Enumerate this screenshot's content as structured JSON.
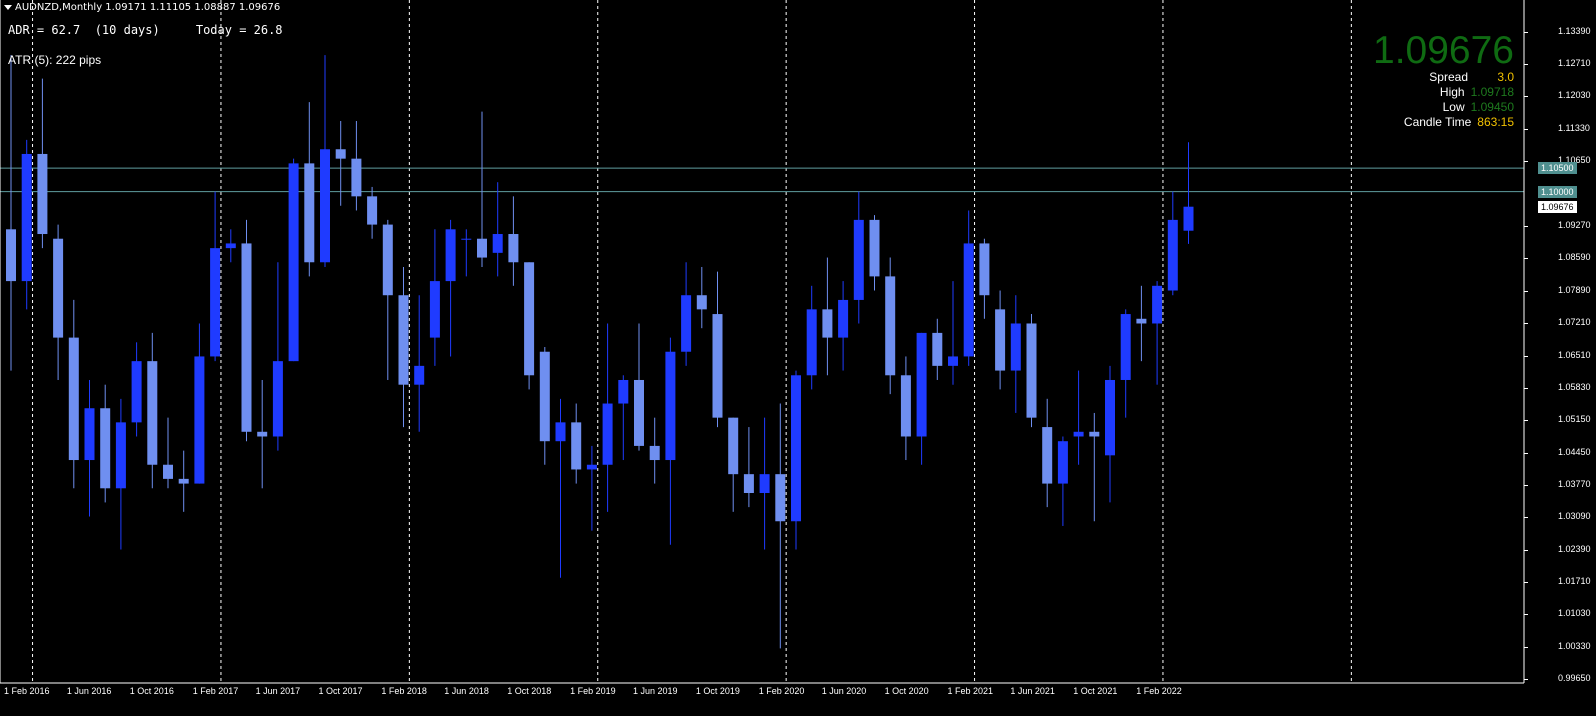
{
  "window": {
    "title": "AUDNZD,Monthly  1.09171 1.11105 1.08887 1.09676"
  },
  "indicators": {
    "adr": "ADR = 62.7  (10 days)     Today = 26.8",
    "atr": "ATR (5): 222 pips"
  },
  "info_panel": {
    "price": "1.09676",
    "spread_label": "Spread",
    "spread_value": "3.0",
    "high_label": "High",
    "high_value": "1.09718",
    "low_label": "Low",
    "low_value": "1.09450",
    "candle_time_label": "Candle Time",
    "candle_time_value": "863:15"
  },
  "price_axis": {
    "ticks": [
      "1.13390",
      "1.12710",
      "1.12030",
      "1.11330",
      "1.10650",
      "1.09270",
      "1.08590",
      "1.07890",
      "1.07210",
      "1.06510",
      "1.05830",
      "1.05150",
      "1.04450",
      "1.03770",
      "1.03090",
      "1.02390",
      "1.01710",
      "1.01030",
      "1.00330",
      "0.99650"
    ],
    "badges": [
      {
        "value": "1.10500",
        "bg": "#4f8f8f",
        "fg": "#ffffff",
        "price": 1.105
      },
      {
        "value": "1.10000",
        "bg": "#4f8f8f",
        "fg": "#ffffff",
        "price": 1.1
      },
      {
        "value": "1.09676",
        "bg": "#ffffff",
        "fg": "#000000",
        "price": 1.09676
      }
    ]
  },
  "time_axis": {
    "labels": [
      "1 Feb 2016",
      "1 Jun 2016",
      "1 Oct 2016",
      "1 Feb 2017",
      "1 Jun 2017",
      "1 Oct 2017",
      "1 Feb 2018",
      "1 Jun 2018",
      "1 Oct 2018",
      "1 Feb 2019",
      "1 Jun 2019",
      "1 Oct 2019",
      "1 Feb 2020",
      "1 Jun 2020",
      "1 Oct 2020",
      "1 Feb 2021",
      "1 Jun 2021",
      "1 Oct 2021",
      "1 Feb 2022"
    ]
  },
  "chart_data": {
    "type": "candlestick",
    "symbol": "AUDNZD",
    "timeframe": "Monthly",
    "y_range": [
      0.9965,
      1.1339
    ],
    "horizontal_levels": [
      1.105,
      1.1
    ],
    "colors": {
      "bull": "#1f3bff",
      "bear": "#6f8ff0",
      "grid": "#ffffff",
      "level": "#5f9ea0"
    },
    "candles": [
      {
        "t": "2015-12",
        "o": 1.092,
        "h": 1.129,
        "l": 1.062,
        "c": 1.081
      },
      {
        "t": "2016-01",
        "o": 1.081,
        "h": 1.111,
        "l": 1.075,
        "c": 1.108
      },
      {
        "t": "2016-02",
        "o": 1.108,
        "h": 1.124,
        "l": 1.088,
        "c": 1.091
      },
      {
        "t": "2016-03",
        "o": 1.09,
        "h": 1.093,
        "l": 1.06,
        "c": 1.069
      },
      {
        "t": "2016-04",
        "o": 1.069,
        "h": 1.077,
        "l": 1.037,
        "c": 1.043
      },
      {
        "t": "2016-05",
        "o": 1.043,
        "h": 1.06,
        "l": 1.031,
        "c": 1.054
      },
      {
        "t": "2016-06",
        "o": 1.054,
        "h": 1.059,
        "l": 1.034,
        "c": 1.037
      },
      {
        "t": "2016-07",
        "o": 1.037,
        "h": 1.056,
        "l": 1.024,
        "c": 1.051
      },
      {
        "t": "2016-08",
        "o": 1.051,
        "h": 1.068,
        "l": 1.048,
        "c": 1.064
      },
      {
        "t": "2016-09",
        "o": 1.064,
        "h": 1.07,
        "l": 1.037,
        "c": 1.042
      },
      {
        "t": "2016-10",
        "o": 1.042,
        "h": 1.052,
        "l": 1.037,
        "c": 1.039
      },
      {
        "t": "2016-11",
        "o": 1.039,
        "h": 1.045,
        "l": 1.032,
        "c": 1.038
      },
      {
        "t": "2016-12",
        "o": 1.038,
        "h": 1.072,
        "l": 1.038,
        "c": 1.065
      },
      {
        "t": "2017-01",
        "o": 1.065,
        "h": 1.1,
        "l": 1.064,
        "c": 1.088
      },
      {
        "t": "2017-02",
        "o": 1.088,
        "h": 1.092,
        "l": 1.085,
        "c": 1.089
      },
      {
        "t": "2017-03",
        "o": 1.089,
        "h": 1.094,
        "l": 1.047,
        "c": 1.049
      },
      {
        "t": "2017-04",
        "o": 1.049,
        "h": 1.06,
        "l": 1.037,
        "c": 1.048
      },
      {
        "t": "2017-05",
        "o": 1.048,
        "h": 1.085,
        "l": 1.045,
        "c": 1.064
      },
      {
        "t": "2017-06",
        "o": 1.064,
        "h": 1.107,
        "l": 1.064,
        "c": 1.106
      },
      {
        "t": "2017-07",
        "o": 1.106,
        "h": 1.119,
        "l": 1.082,
        "c": 1.085
      },
      {
        "t": "2017-08",
        "o": 1.085,
        "h": 1.129,
        "l": 1.084,
        "c": 1.109
      },
      {
        "t": "2017-09",
        "o": 1.109,
        "h": 1.115,
        "l": 1.097,
        "c": 1.107
      },
      {
        "t": "2017-10",
        "o": 1.107,
        "h": 1.115,
        "l": 1.096,
        "c": 1.099
      },
      {
        "t": "2017-11",
        "o": 1.099,
        "h": 1.101,
        "l": 1.09,
        "c": 1.093
      },
      {
        "t": "2017-12",
        "o": 1.093,
        "h": 1.094,
        "l": 1.06,
        "c": 1.078
      },
      {
        "t": "2018-01",
        "o": 1.078,
        "h": 1.084,
        "l": 1.05,
        "c": 1.059
      },
      {
        "t": "2018-02",
        "o": 1.059,
        "h": 1.078,
        "l": 1.049,
        "c": 1.063
      },
      {
        "t": "2018-03",
        "o": 1.069,
        "h": 1.092,
        "l": 1.063,
        "c": 1.081
      },
      {
        "t": "2018-04",
        "o": 1.081,
        "h": 1.094,
        "l": 1.065,
        "c": 1.092
      },
      {
        "t": "2018-05",
        "o": 1.09,
        "h": 1.092,
        "l": 1.082,
        "c": 1.09
      },
      {
        "t": "2018-06",
        "o": 1.09,
        "h": 1.117,
        "l": 1.084,
        "c": 1.086
      },
      {
        "t": "2018-07",
        "o": 1.087,
        "h": 1.102,
        "l": 1.082,
        "c": 1.091
      },
      {
        "t": "2018-08",
        "o": 1.091,
        "h": 1.099,
        "l": 1.08,
        "c": 1.085
      },
      {
        "t": "2018-09",
        "o": 1.085,
        "h": 1.085,
        "l": 1.058,
        "c": 1.061
      },
      {
        "t": "2018-10",
        "o": 1.066,
        "h": 1.067,
        "l": 1.042,
        "c": 1.047
      },
      {
        "t": "2018-11",
        "o": 1.047,
        "h": 1.056,
        "l": 1.018,
        "c": 1.051
      },
      {
        "t": "2018-12",
        "o": 1.051,
        "h": 1.055,
        "l": 1.038,
        "c": 1.041
      },
      {
        "t": "2019-01",
        "o": 1.041,
        "h": 1.046,
        "l": 1.028,
        "c": 1.042
      },
      {
        "t": "2019-02",
        "o": 1.042,
        "h": 1.072,
        "l": 1.032,
        "c": 1.055
      },
      {
        "t": "2019-03",
        "o": 1.055,
        "h": 1.061,
        "l": 1.043,
        "c": 1.06
      },
      {
        "t": "2019-04",
        "o": 1.06,
        "h": 1.072,
        "l": 1.045,
        "c": 1.046
      },
      {
        "t": "2019-05",
        "o": 1.046,
        "h": 1.052,
        "l": 1.038,
        "c": 1.043
      },
      {
        "t": "2019-06",
        "o": 1.043,
        "h": 1.069,
        "l": 1.025,
        "c": 1.066
      },
      {
        "t": "2019-07",
        "o": 1.066,
        "h": 1.085,
        "l": 1.063,
        "c": 1.078
      },
      {
        "t": "2019-08",
        "o": 1.078,
        "h": 1.084,
        "l": 1.071,
        "c": 1.075
      },
      {
        "t": "2019-09",
        "o": 1.074,
        "h": 1.083,
        "l": 1.05,
        "c": 1.052
      },
      {
        "t": "2019-10",
        "o": 1.052,
        "h": 1.052,
        "l": 1.032,
        "c": 1.04
      },
      {
        "t": "2019-11",
        "o": 1.04,
        "h": 1.05,
        "l": 1.033,
        "c": 1.036
      },
      {
        "t": "2019-12",
        "o": 1.036,
        "h": 1.052,
        "l": 1.024,
        "c": 1.04
      },
      {
        "t": "2020-01",
        "o": 1.04,
        "h": 1.055,
        "l": 1.003,
        "c": 1.03
      },
      {
        "t": "2020-02",
        "o": 1.03,
        "h": 1.062,
        "l": 1.024,
        "c": 1.061
      },
      {
        "t": "2020-03",
        "o": 1.061,
        "h": 1.08,
        "l": 1.058,
        "c": 1.075
      },
      {
        "t": "2020-04",
        "o": 1.075,
        "h": 1.086,
        "l": 1.061,
        "c": 1.069
      },
      {
        "t": "2020-05",
        "o": 1.069,
        "h": 1.081,
        "l": 1.062,
        "c": 1.077
      },
      {
        "t": "2020-06",
        "o": 1.077,
        "h": 1.1,
        "l": 1.072,
        "c": 1.094
      },
      {
        "t": "2020-07",
        "o": 1.094,
        "h": 1.095,
        "l": 1.079,
        "c": 1.082
      },
      {
        "t": "2020-08",
        "o": 1.082,
        "h": 1.086,
        "l": 1.057,
        "c": 1.061
      },
      {
        "t": "2020-09",
        "o": 1.061,
        "h": 1.065,
        "l": 1.043,
        "c": 1.048
      },
      {
        "t": "2020-10",
        "o": 1.048,
        "h": 1.07,
        "l": 1.042,
        "c": 1.07
      },
      {
        "t": "2020-11",
        "o": 1.07,
        "h": 1.073,
        "l": 1.06,
        "c": 1.063
      },
      {
        "t": "2020-12",
        "o": 1.063,
        "h": 1.081,
        "l": 1.059,
        "c": 1.065
      },
      {
        "t": "2021-01",
        "o": 1.065,
        "h": 1.096,
        "l": 1.063,
        "c": 1.089
      },
      {
        "t": "2021-02",
        "o": 1.089,
        "h": 1.09,
        "l": 1.073,
        "c": 1.078
      },
      {
        "t": "2021-03",
        "o": 1.075,
        "h": 1.079,
        "l": 1.058,
        "c": 1.062
      },
      {
        "t": "2021-04",
        "o": 1.062,
        "h": 1.078,
        "l": 1.053,
        "c": 1.072
      },
      {
        "t": "2021-05",
        "o": 1.072,
        "h": 1.074,
        "l": 1.05,
        "c": 1.052
      },
      {
        "t": "2021-06",
        "o": 1.05,
        "h": 1.056,
        "l": 1.033,
        "c": 1.038
      },
      {
        "t": "2021-07",
        "o": 1.038,
        "h": 1.048,
        "l": 1.029,
        "c": 1.047
      },
      {
        "t": "2021-08",
        "o": 1.048,
        "h": 1.062,
        "l": 1.042,
        "c": 1.049
      },
      {
        "t": "2021-09",
        "o": 1.049,
        "h": 1.053,
        "l": 1.03,
        "c": 1.048
      },
      {
        "t": "2021-10",
        "o": 1.044,
        "h": 1.063,
        "l": 1.034,
        "c": 1.06
      },
      {
        "t": "2021-11",
        "o": 1.06,
        "h": 1.075,
        "l": 1.052,
        "c": 1.074
      },
      {
        "t": "2021-12",
        "o": 1.073,
        "h": 1.08,
        "l": 1.064,
        "c": 1.072
      },
      {
        "t": "2022-01",
        "o": 1.072,
        "h": 1.081,
        "l": 1.059,
        "c": 1.08
      },
      {
        "t": "2022-02",
        "o": 1.079,
        "h": 1.1,
        "l": 1.078,
        "c": 1.094
      },
      {
        "t": "2022-03",
        "o": 1.0917,
        "h": 1.1105,
        "l": 1.0889,
        "c": 1.0968
      }
    ]
  }
}
